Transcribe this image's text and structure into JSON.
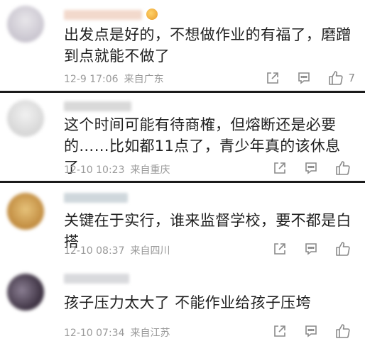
{
  "comments": [
    {
      "text": "出发点是好的，不想做作业的有福了，磨蹭到点就能不做了",
      "date": "12-9 17:06",
      "location": "来自广东",
      "likes": "7",
      "avatar_colors": [
        "#c9c5cf",
        "#e8e6ea"
      ],
      "username_color": "#f2d9cc",
      "has_vip_badge": true
    },
    {
      "text": "这个时间可能有待商榷，但熔断还是必要的……比如都11点了，青少年真的该休息了",
      "date": "12-10 10:23",
      "location": "来自重庆",
      "likes": "",
      "avatar_colors": [
        "#d6d6d6",
        "#f1f1f1"
      ],
      "username_color": "#d9d9d9",
      "has_vip_badge": false
    },
    {
      "text": "关键在于实行，谁来监督学校，要不都是白搭",
      "date": "12-10 08:37",
      "location": "来自四川",
      "likes": "",
      "avatar_colors": [
        "#c08a3e",
        "#e6c27a"
      ],
      "username_color": "#cfd7dc",
      "has_vip_badge": false
    },
    {
      "text": "孩子压力太大了 不能作业给孩子压垮",
      "date": "12-10 07:34",
      "location": "来自江苏",
      "likes": "",
      "avatar_colors": [
        "#3a2f3f",
        "#8a7e92"
      ],
      "username_color": "#d9dadd",
      "has_vip_badge": false
    }
  ],
  "icons": {
    "share": "share-icon",
    "comment": "comment-icon",
    "like": "thumbs-up-icon"
  },
  "colors": {
    "text": "#1f1f1f",
    "meta": "#9a9a9a",
    "icon": "#8a8a8a",
    "divider": "#1a1a1a"
  }
}
